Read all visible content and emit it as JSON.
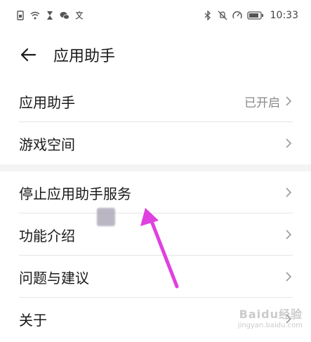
{
  "status_bar": {
    "time": "10:33",
    "left_icons": [
      "sim-icon",
      "wifi-icon",
      "hourglass-icon",
      "wechat-icon",
      "translate-icon"
    ],
    "right_icons": [
      "bluetooth-icon",
      "mute-icon",
      "speed-icon",
      "battery-icon"
    ]
  },
  "header": {
    "title": "应用助手"
  },
  "list_top": [
    {
      "label": "应用助手",
      "value": "已开启"
    },
    {
      "label": "游戏空间",
      "value": ""
    }
  ],
  "list_bottom": [
    {
      "label": "停止应用助手服务",
      "value": ""
    },
    {
      "label": "功能介绍",
      "value": ""
    },
    {
      "label": "问题与建议",
      "value": ""
    },
    {
      "label": "关于",
      "value": ""
    }
  ],
  "annotation": {
    "arrow_color": "#e040e0"
  },
  "watermark": {
    "main": "Baidu经验",
    "sub": "jingyan.baidu.com"
  }
}
